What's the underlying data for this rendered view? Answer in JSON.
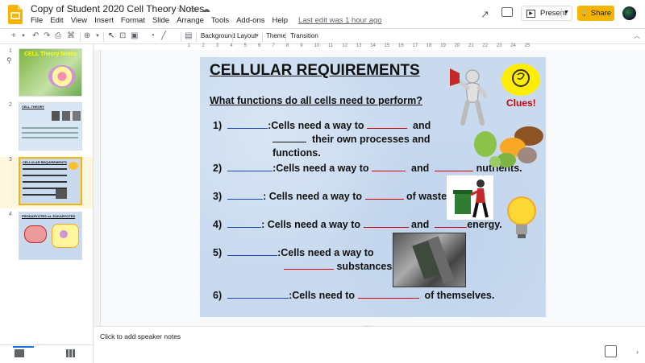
{
  "app": {
    "title": "Copy of Student 2020 Cell Theory Notes",
    "icons": [
      "star-icon",
      "folder-icon",
      "cloud-icon"
    ]
  },
  "menu": {
    "items": [
      "File",
      "Edit",
      "View",
      "Insert",
      "Format",
      "Slide",
      "Arrange",
      "Tools",
      "Add-ons",
      "Help"
    ],
    "last_edit": "Last edit was 1 hour ago"
  },
  "header_right": {
    "present_label": "Present",
    "share_label": "Share"
  },
  "toolbar": {
    "background_label": "Background",
    "layout_label": "Layout",
    "theme_label": "Theme",
    "transition_label": "Transition"
  },
  "ruler": {
    "marks": [
      "1",
      "2",
      "3",
      "4",
      "5",
      "6",
      "7",
      "8",
      "9",
      "10",
      "11",
      "12",
      "13",
      "14",
      "15",
      "16",
      "17",
      "18",
      "19",
      "20",
      "21",
      "22",
      "23",
      "24",
      "25"
    ]
  },
  "filmstrip": {
    "slides": [
      {
        "num": "1",
        "title": "CELL Theory Notes"
      },
      {
        "num": "2",
        "title": "CELL THEORY"
      },
      {
        "num": "3",
        "title": "CELLULAR REQUIREMENTS"
      },
      {
        "num": "4",
        "title": "PROKARYOTES vs. EUKARYOTES"
      }
    ],
    "selected": 3
  },
  "slide": {
    "title": "CELLULAR REQUIREMENTS",
    "subtitle": "What functions do all cells need to perform?",
    "clues_label": "Clues!",
    "q1": {
      "num": "1)",
      "a": ":Cells need a way to",
      "b": "and",
      "c": "their own processes and",
      "d": "functions."
    },
    "q2": {
      "num": "2)",
      "a": ":Cells need a way to",
      "b": "and",
      "c": "nutrients."
    },
    "q3": {
      "num": "3)",
      "a": ": Cells need a way to",
      "b": "of waste."
    },
    "q4": {
      "num": "4)",
      "a": ":  Cells need a way to",
      "b": "and",
      "c": "energy."
    },
    "q5": {
      "num": "5)",
      "a": ":Cells need a way to",
      "b": "substances."
    },
    "q6": {
      "num": "6)",
      "a": ":Cells need to",
      "b": "of themselves."
    }
  },
  "notes": {
    "placeholder": "Click to add speaker notes"
  },
  "colors": {
    "accent": "#f4b400",
    "slide_bg": "#c9daef",
    "blank_red": "#cc0000",
    "blank_blue": "#1a47b8",
    "selected_thumb_bg": "#fef7e0"
  }
}
